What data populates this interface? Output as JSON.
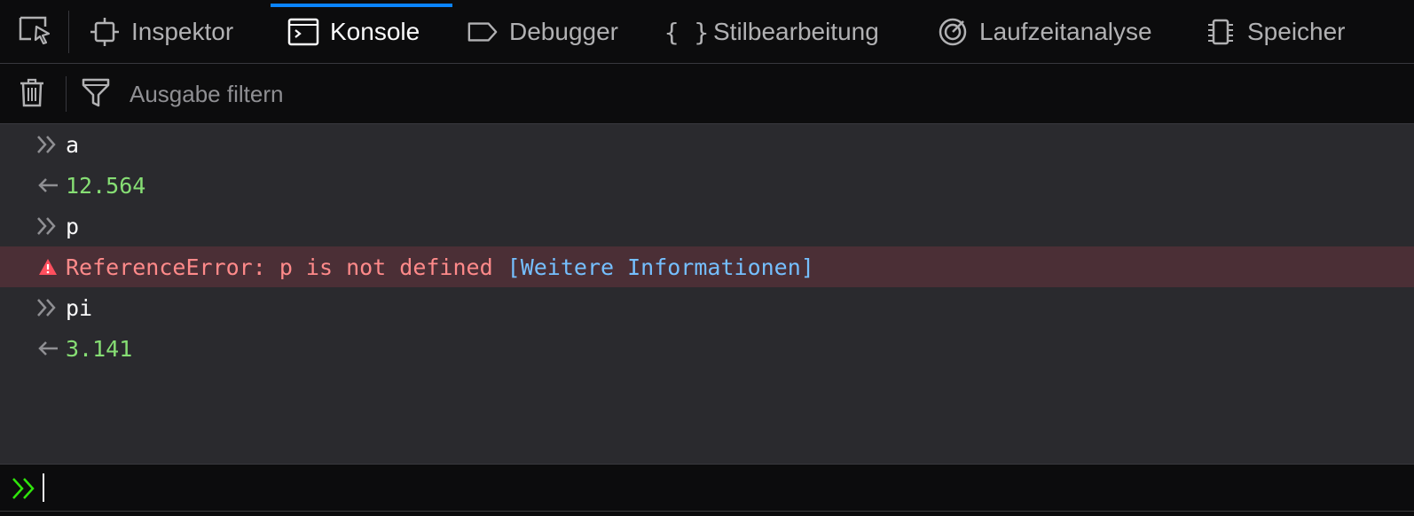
{
  "tabs": [
    {
      "label": "Inspektor",
      "icon": "inspector-icon",
      "active": false
    },
    {
      "label": "Konsole",
      "icon": "console-icon",
      "active": true
    },
    {
      "label": "Debugger",
      "icon": "debugger-icon",
      "active": false
    },
    {
      "label": "Stilbearbeitung",
      "icon": "braces-icon",
      "active": false
    },
    {
      "label": "Laufzeitanalyse",
      "icon": "performance-icon",
      "active": false
    },
    {
      "label": "Speicher",
      "icon": "memory-icon",
      "active": false
    }
  ],
  "toolbar": {
    "filter_placeholder": "Ausgabe filtern",
    "clear_icon": "trash-icon",
    "filter_icon": "funnel-icon"
  },
  "console": {
    "entries": [
      {
        "kind": "input",
        "text": "a"
      },
      {
        "kind": "result",
        "text": "12.564"
      },
      {
        "kind": "input",
        "text": "p"
      },
      {
        "kind": "error",
        "text": "ReferenceError: p is not defined",
        "link": "[Weitere Informationen]"
      },
      {
        "kind": "input",
        "text": "pi"
      },
      {
        "kind": "result",
        "text": "3.141"
      }
    ],
    "input_value": ""
  },
  "colors": {
    "accent": "#0a84ff",
    "result": "#86de74",
    "error_text": "#ff8a8a",
    "error_bg": "#4b2f36",
    "link": "#75bfff",
    "prompt": "#30e60b"
  }
}
